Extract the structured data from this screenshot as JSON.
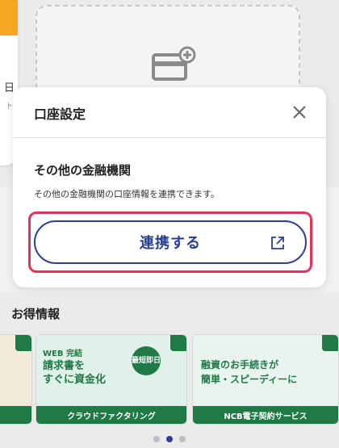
{
  "background": {
    "left_card_fragment": "日",
    "left_card_fragment2": "ト"
  },
  "modal": {
    "title": "口座設定",
    "close_icon": "close-icon",
    "heading": "その他の金融機関",
    "description": "その他の金融機関の口座情報を連携できます。",
    "link_button_label": "連携する",
    "link_button_icon": "external-link-icon",
    "highlight_color": "#e2345a",
    "accent_color": "#2b3f93"
  },
  "otoku": {
    "title": "お得情報",
    "banners": [
      {
        "caption": "",
        "headline": ""
      },
      {
        "caption": "クラウドファクタリング",
        "tag": "WEB 完結",
        "headline_line1": "請求書を",
        "headline_line2": "すぐに資金化",
        "badge": "最短即日"
      },
      {
        "caption": "NCB電子契約サービス",
        "headline_line1": "融資のお手続きが",
        "headline_line2": "簡単・スピーディーに"
      }
    ]
  },
  "pagination": {
    "total": 3,
    "active": 2
  }
}
